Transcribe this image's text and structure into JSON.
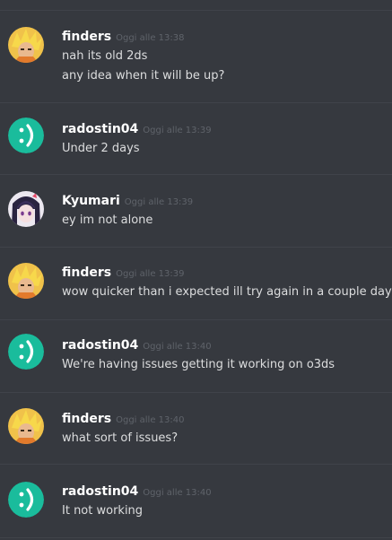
{
  "messages": [
    {
      "author": "finders",
      "avatar": "finders-avatar",
      "timestamp": "Oggi alle 13:38",
      "lines": [
        "nah its old 2ds",
        "any idea when it will be up?"
      ]
    },
    {
      "author": "radostin04",
      "avatar": "smiley-avatar",
      "timestamp": "Oggi alle 13:39",
      "lines": [
        "Under 2 days"
      ]
    },
    {
      "author": "Kyumari",
      "avatar": "kyumari-avatar",
      "timestamp": "Oggi alle 13:39",
      "lines": [
        "ey im not alone"
      ]
    },
    {
      "author": "finders",
      "avatar": "finders-avatar",
      "timestamp": "Oggi alle 13:39",
      "lines": [
        "wow quicker than i expected ill try again in a couple days"
      ]
    },
    {
      "author": "radostin04",
      "avatar": "smiley-avatar",
      "timestamp": "Oggi alle 13:40",
      "lines": [
        "We're having issues getting it working on o3ds"
      ]
    },
    {
      "author": "finders",
      "avatar": "finders-avatar",
      "timestamp": "Oggi alle 13:40",
      "lines": [
        "what sort of issues?"
      ]
    },
    {
      "author": "radostin04",
      "avatar": "smiley-avatar",
      "timestamp": "Oggi alle 13:40",
      "lines": [
        "It not working"
      ]
    }
  ],
  "colors": {
    "background": "#36393f",
    "divider": "#40434a",
    "smiley_green": "#1abc9c"
  }
}
